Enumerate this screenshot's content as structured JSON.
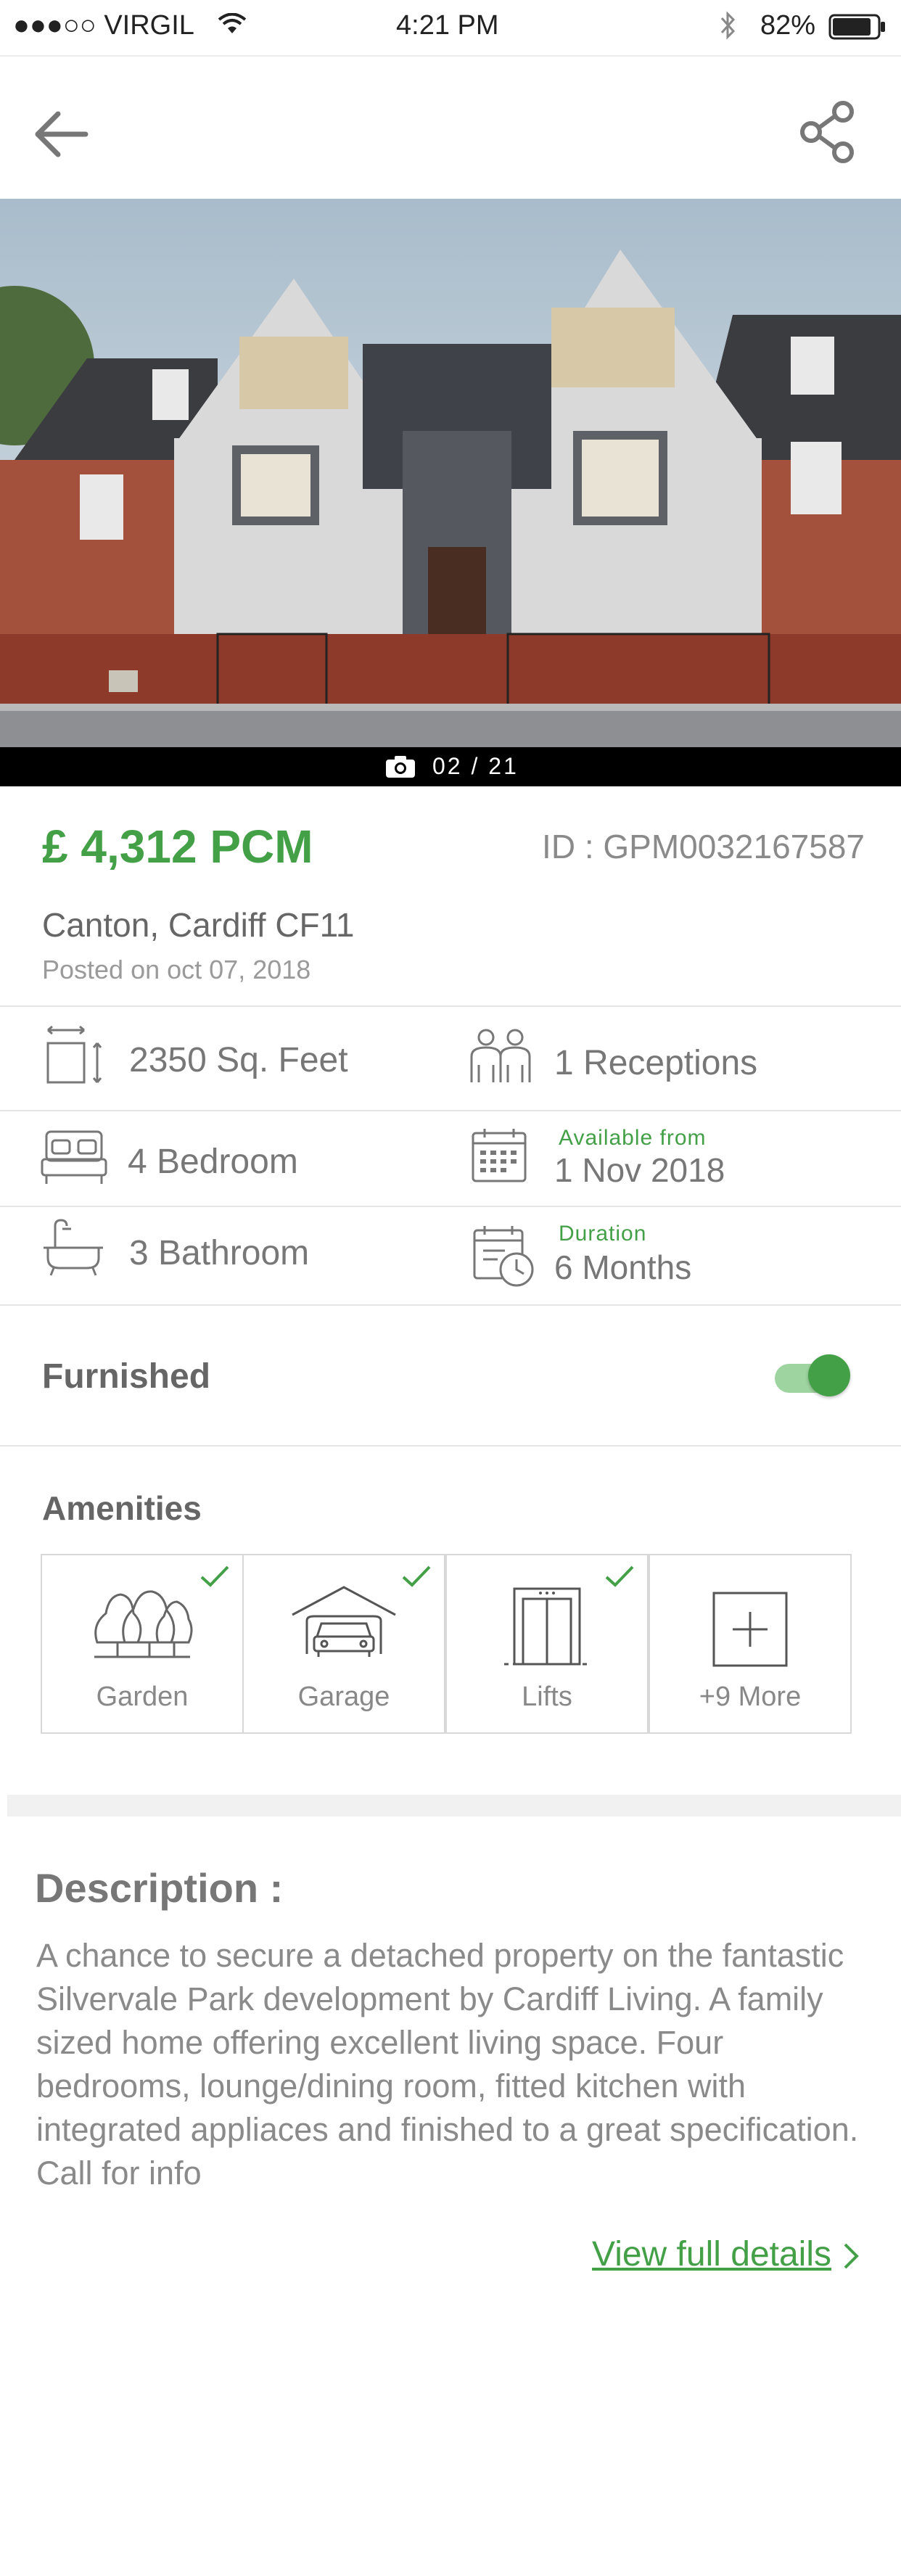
{
  "status_bar": {
    "carrier": "●●●○○ VIRGIL",
    "time": "4:21 PM",
    "battery": "82%"
  },
  "header": {
    "back_icon": "arrow-left-icon",
    "share_icon": "share-icon"
  },
  "gallery": {
    "counter": "02 / 21",
    "camera_icon": "camera-icon"
  },
  "listing": {
    "price": "£ 4,312 PCM",
    "id": "ID : GPM0032167587",
    "address": "Canton, Cardiff CF11",
    "posted": "Posted on oct 07, 2018"
  },
  "features": {
    "area": "2350 Sq. Feet",
    "receptions": "1 Receptions",
    "bedrooms": "4 Bedroom",
    "available_label": "Available from",
    "available_value": "1 Nov 2018",
    "bathrooms": "3 Bathroom",
    "duration_label": "Duration",
    "duration_value": "6 Months"
  },
  "furnished": {
    "label": "Furnished",
    "on": true
  },
  "amenities": {
    "title": "Amenities",
    "items": [
      {
        "label": "Garden",
        "checked": true
      },
      {
        "label": "Garage",
        "checked": true
      },
      {
        "label": "Lifts",
        "checked": true
      },
      {
        "label": "+9 More",
        "checked": false
      }
    ]
  },
  "description": {
    "title": "Description :",
    "body": "A chance to secure a detached property on the fantastic Silvervale Park development by Cardiff Living. A family sized home offering excellent living space. Four bedrooms, lounge/dining room, fitted kitchen with integrated appliaces and finished to a great specification. Call for info",
    "link": "View full details"
  },
  "colors": {
    "accent": "#43a047",
    "text": "#666666",
    "muted": "#9a9a9a"
  }
}
